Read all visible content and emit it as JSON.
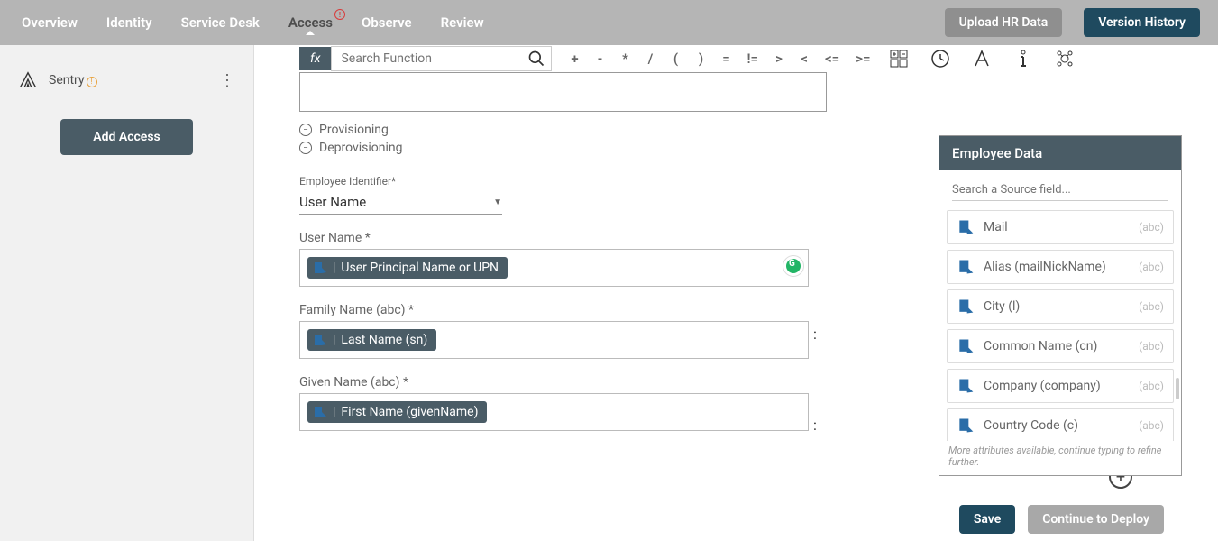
{
  "nav": {
    "tabs": [
      "Overview",
      "Identity",
      "Service Desk",
      "Access",
      "Observe",
      "Review"
    ],
    "active_index": 3,
    "upload_btn": "Upload HR Data",
    "version_btn": "Version History"
  },
  "sidebar": {
    "app_name": "Sentry",
    "add_btn": "Add Access"
  },
  "formula": {
    "fx_label": "fx",
    "search_placeholder": "Search Function",
    "operators": [
      "+",
      "-",
      "*",
      "/",
      "(",
      ")",
      "=",
      "!=",
      ">",
      "<",
      "<=",
      ">="
    ]
  },
  "sections": {
    "provisioning": "Provisioning",
    "deprovisioning": "Deprovisioning"
  },
  "form": {
    "emp_id_label": "Employee Identifier*",
    "emp_id_value": "User Name",
    "username_label": "User Name *",
    "username_tag": "User Principal Name or UPN",
    "family_label": "Family Name (abc) *",
    "family_tag": "Last Name (sn)",
    "given_label": "Given Name (abc) *",
    "given_tag": "First Name (givenName)"
  },
  "source_panel": {
    "title": "Employee Data",
    "search_placeholder": "Search a Source field...",
    "items": [
      {
        "name": "Mail",
        "type": "(abc)"
      },
      {
        "name": "Alias (mailNickName)",
        "type": "(abc)"
      },
      {
        "name": "City (l)",
        "type": "(abc)"
      },
      {
        "name": "Common Name (cn)",
        "type": "(abc)"
      },
      {
        "name": "Company (company)",
        "type": "(abc)"
      },
      {
        "name": "Country Code (c)",
        "type": "(abc)"
      }
    ],
    "footer": "More attributes available, continue typing to refine further."
  },
  "buttons": {
    "save": "Save",
    "continue": "Continue to Deploy"
  }
}
